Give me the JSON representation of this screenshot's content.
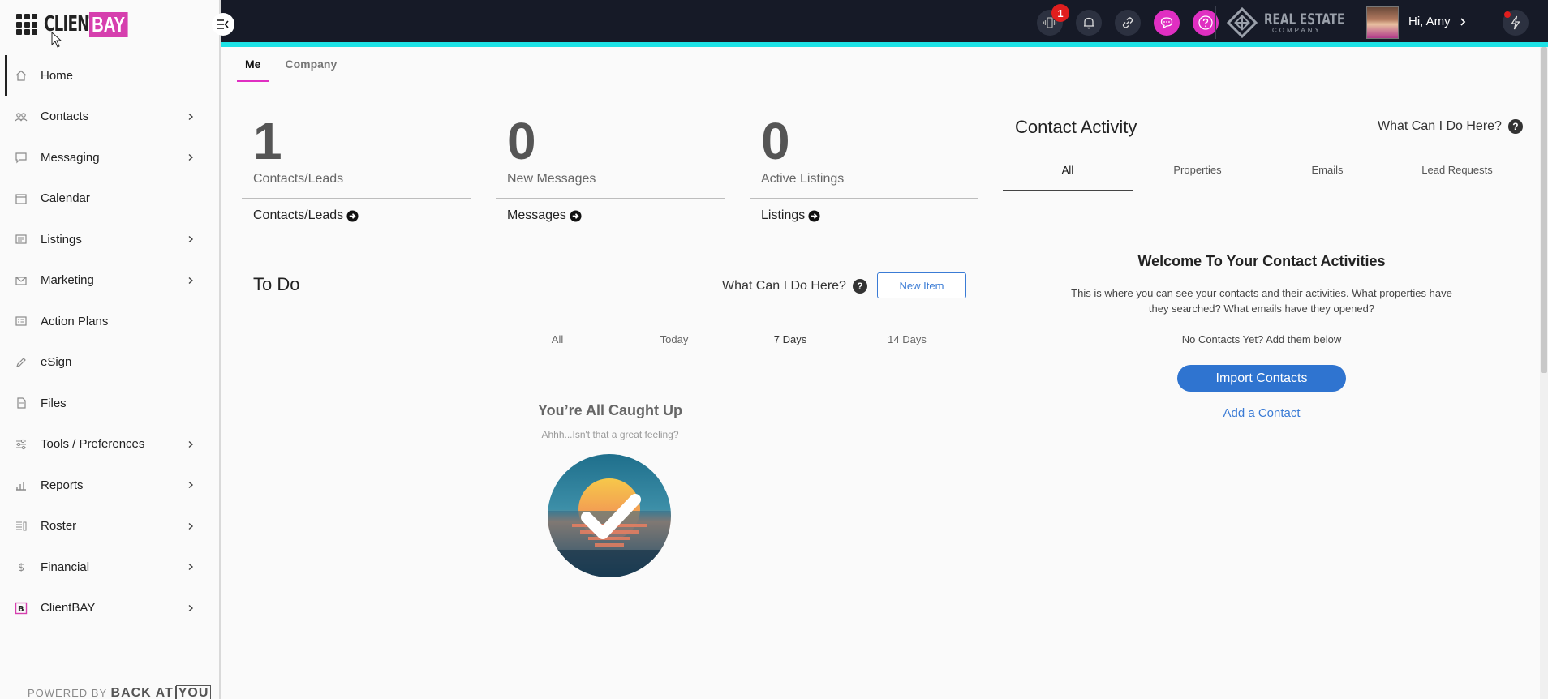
{
  "brand": {
    "client": "CLIENT",
    "bay": "BAY"
  },
  "sidebar": {
    "items": [
      {
        "label": "Home",
        "icon": "home-icon",
        "has_submenu": false
      },
      {
        "label": "Contacts",
        "icon": "contacts-icon",
        "has_submenu": true
      },
      {
        "label": "Messaging",
        "icon": "message-icon",
        "has_submenu": true
      },
      {
        "label": "Calendar",
        "icon": "calendar-icon",
        "has_submenu": false
      },
      {
        "label": "Listings",
        "icon": "listings-icon",
        "has_submenu": true
      },
      {
        "label": "Marketing",
        "icon": "envelope-icon",
        "has_submenu": true
      },
      {
        "label": "Action Plans",
        "icon": "action-plans-icon",
        "has_submenu": false
      },
      {
        "label": "eSign",
        "icon": "pen-icon",
        "has_submenu": false
      },
      {
        "label": "Files",
        "icon": "file-icon",
        "has_submenu": false
      },
      {
        "label": "Tools / Preferences",
        "icon": "sliders-icon",
        "has_submenu": true
      },
      {
        "label": "Reports",
        "icon": "bar-chart-icon",
        "has_submenu": true
      },
      {
        "label": "Roster",
        "icon": "roster-icon",
        "has_submenu": true
      },
      {
        "label": "Financial",
        "icon": "dollar-icon",
        "has_submenu": true
      },
      {
        "label": "ClientBAY",
        "icon": "clientbay-icon",
        "has_submenu": true
      }
    ],
    "powered_by": "POWERED BY",
    "powered_brand_1": "BACK AT",
    "powered_brand_2": "YOU"
  },
  "topbar": {
    "notification_count": "1",
    "company_logo_text": "REAL ESTATE",
    "company_logo_sub": "COMPANY",
    "greeting": "Hi, Amy"
  },
  "main_tabs": [
    {
      "label": "Me",
      "active": true
    },
    {
      "label": "Company",
      "active": false
    }
  ],
  "stats": [
    {
      "value": "1",
      "label": "Contacts/Leads",
      "link": "Contacts/Leads"
    },
    {
      "value": "0",
      "label": "New Messages",
      "link": "Messages"
    },
    {
      "value": "0",
      "label": "Active Listings",
      "link": "Listings"
    }
  ],
  "todo": {
    "title": "To Do",
    "help": "What Can I Do Here?",
    "new_item": "New Item",
    "filters": [
      "All",
      "Today",
      "7 Days",
      "14 Days"
    ],
    "active_filter": "7 Days",
    "caught_up_title": "You’re All Caught Up",
    "caught_up_sub": "Ahhh...Isn't that a great feeling?"
  },
  "contact_activity": {
    "title": "Contact Activity",
    "help": "What Can I Do Here?",
    "tabs": [
      "All",
      "Properties",
      "Emails",
      "Lead Requests"
    ],
    "active_tab": "All",
    "welcome": "Welcome To Your Contact Activities",
    "description": "This is where you can see your contacts and their activities. What properties have they searched? What emails have they opened?",
    "no_contacts": "No Contacts Yet? Add them below",
    "import_button": "Import Contacts",
    "add_link": "Add a Contact"
  },
  "colors": {
    "accent_pink": "#e02fc2",
    "topbar_bg": "#161a27",
    "topbar_stripe": "#1de2e6",
    "primary_blue": "#2f74d0"
  }
}
